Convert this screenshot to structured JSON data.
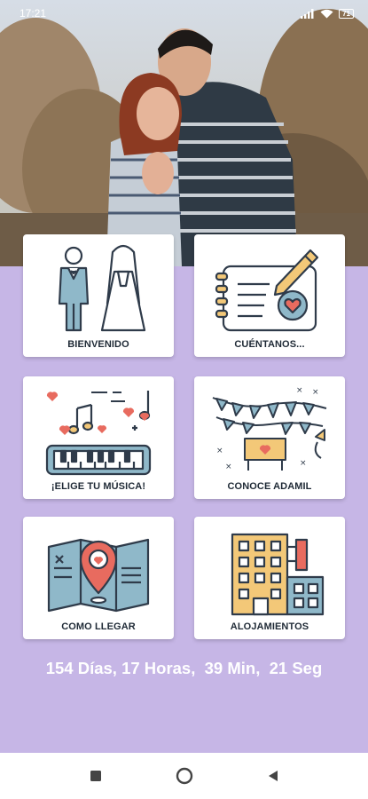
{
  "status_bar": {
    "time": "17:21",
    "battery": "71",
    "icons": [
      "signal-icon",
      "wifi-icon",
      "battery-icon"
    ]
  },
  "hero": {
    "photo": "couple-photo"
  },
  "colors": {
    "background": "#c6b6e6",
    "icon_dark": "#2f3b4a",
    "icon_blue": "#8fb8c9",
    "icon_red": "#e86b5f",
    "icon_yellow": "#f3c878"
  },
  "menu": [
    {
      "label": "BIENVENIDO",
      "icon": "bride-groom-icon"
    },
    {
      "label": "CUÉNTANOS...",
      "icon": "notepad-heart-icon"
    },
    {
      "label": "¡ELIGE TU MÚSICA!",
      "icon": "piano-music-icon"
    },
    {
      "label": "CONOCE ADAMIL",
      "icon": "party-banner-icon"
    },
    {
      "label": "COMO LLEGAR",
      "icon": "map-pin-icon"
    },
    {
      "label": "ALOJAMIENTOS",
      "icon": "hotel-building-icon"
    }
  ],
  "countdown": "154 Días, 17 Horas,  39 Min,  21 Seg",
  "navbar": {
    "icons": [
      "recents-square-icon",
      "home-circle-icon",
      "back-triangle-icon"
    ]
  }
}
